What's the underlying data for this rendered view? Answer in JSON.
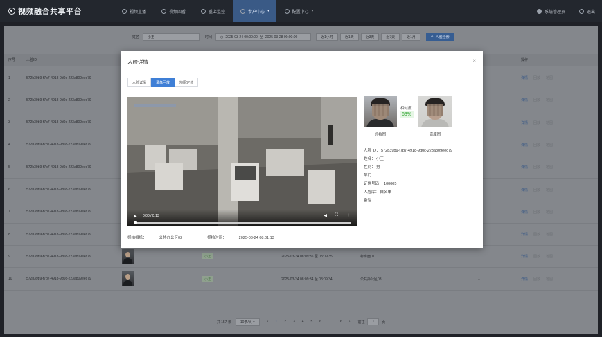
{
  "app": {
    "title": "视频融合共享平台"
  },
  "nav": [
    {
      "label": "视频直播"
    },
    {
      "label": "视频回看"
    },
    {
      "label": "重上监控"
    },
    {
      "label": "参户中心",
      "active": true
    },
    {
      "label": "配置中心"
    }
  ],
  "header_right": {
    "user": "系统管理员",
    "logout": "退出"
  },
  "search": {
    "name_label": "姓名",
    "name_value": "小王",
    "time_label": "时间",
    "start": "2025-03-24 00:00:00",
    "end": "2025-03-28 00:00:00",
    "quick": [
      "近1小时",
      "近1天",
      "近3天",
      "近7天",
      "近1月"
    ],
    "search_btn": "人脸检索"
  },
  "table": {
    "headers": [
      "序号",
      "人脸ID",
      "",
      "",
      "",
      "",
      "",
      "操作"
    ],
    "rows": [
      {
        "idx": "1",
        "face_id": "572b39b9-f7b7-4918-9d0c-223a809eec79",
        "actions": [
          "详情",
          "回放",
          "地图"
        ]
      },
      {
        "idx": "2",
        "face_id": "572b39b9-f7b7-4918-9d0c-223a809eec79",
        "actions": [
          "详情",
          "回放",
          "地图"
        ]
      },
      {
        "idx": "3",
        "face_id": "572b39b9-f7b7-4918-9d0c-223a809eec79",
        "actions": [
          "详情",
          "回放",
          "地图"
        ]
      },
      {
        "idx": "4",
        "face_id": "572b39b9-f7b7-4918-9d0c-223a809eec79",
        "actions": [
          "详情",
          "回放",
          "地图"
        ]
      },
      {
        "idx": "5",
        "face_id": "572b39b9-f7b7-4918-9d0c-223a809eec79",
        "actions": [
          "详情",
          "回放",
          "地图"
        ]
      },
      {
        "idx": "6",
        "face_id": "572b39b9-f7b7-4918-9d0c-223a809eec79",
        "actions": [
          "详情",
          "回放",
          "地图"
        ]
      },
      {
        "idx": "7",
        "face_id": "572b39b9-f7b7-4918-9d0c-223a809eec79",
        "actions": [
          "详情",
          "回放",
          "地图"
        ]
      },
      {
        "idx": "8",
        "face_id": "572b39b9-f7b7-4918-9d0c-223a809eec79",
        "actions": [
          "详情",
          "回放",
          "地图"
        ]
      },
      {
        "idx": "9",
        "face_id": "572b39b9-f7b7-4918-9d0c-223a809eec79",
        "name": "小王",
        "time": "2025-03-24 08:09:35 至 08:09:35",
        "place": "标准面01",
        "count": "1",
        "actions": [
          "详情",
          "回放",
          "地图"
        ]
      },
      {
        "idx": "10",
        "face_id": "572b39b9-f7b7-4918-9d0c-223a809eec79",
        "name": "小王",
        "time": "2025-03-24 08:09:34 至 08:09:34",
        "place": "公共办公区03",
        "count": "1",
        "actions": [
          "详情",
          "回放",
          "地图"
        ]
      }
    ]
  },
  "pager": {
    "total": "共 157 条",
    "size": "10条/页",
    "pages": [
      "1",
      "2",
      "3",
      "4",
      "5",
      "6",
      "...",
      "16"
    ],
    "goto": "前往",
    "page_input": "1",
    "page_unit": "页"
  },
  "modal": {
    "title": "人脸详情",
    "close": "×",
    "tabs": [
      "人脸详情",
      "录像回放",
      "地图定位"
    ],
    "active_tab": 1,
    "video": {
      "time": "0:00 / 0:13"
    },
    "camera_label": "抓拍相机：",
    "camera_value": "公共办公区02",
    "capture_time_label": "抓拍时间：",
    "capture_time_value": "2025-03-24 08:01:13",
    "capture_caption": "抓拍图",
    "library_caption": "底库图",
    "similarity_label": "相似度",
    "similarity_value": "63%",
    "details": [
      "人脸 ID： 572b39b9-f7b7-4918-9d0c-223a809eec79",
      "姓名： 小王",
      "性别： 男",
      "部门：",
      "证件号码： 100005",
      "人脸库： 白名单",
      "备注："
    ]
  }
}
